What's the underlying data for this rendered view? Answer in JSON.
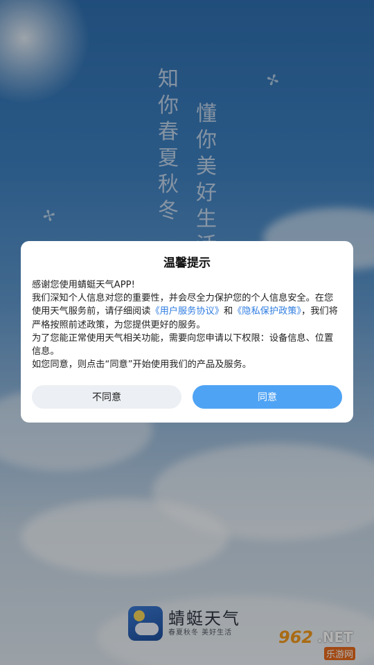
{
  "background": {
    "slogan_line_1": "知你春夏秋冬",
    "slogan_line_2": "懂你美好生活"
  },
  "dialog": {
    "title": "温馨提示",
    "p1": "感谢您使用蜻蜓天气APP!",
    "p2_a": "我们深知个人信息对您的重要性，并会尽全力保护您的个人信息安全。在您使用天气服务前，请仔细阅读",
    "link_user_agreement": "《用户服务协议》",
    "p2_and": "和",
    "link_privacy_policy": "《隐私保护政策》",
    "p2_b": "，我们将严格按照前述政策，为您提供更好的服务。",
    "p3": "为了您能正常使用天气相关功能，需要向您申请以下权限：设备信息、位置信息。",
    "p4": "如您同意，则点击“同意”开始使用我们的产品及服务。",
    "disagree_label": "不同意",
    "agree_label": "同意"
  },
  "brand": {
    "name": "蜻蜓天气",
    "tagline": "春夏秋冬 美好生活"
  },
  "watermark": {
    "number": "962",
    "suffix": ".NET",
    "chinese": "乐游网"
  },
  "colors": {
    "accent": "#4fa3f4",
    "link": "#2f7de1"
  }
}
